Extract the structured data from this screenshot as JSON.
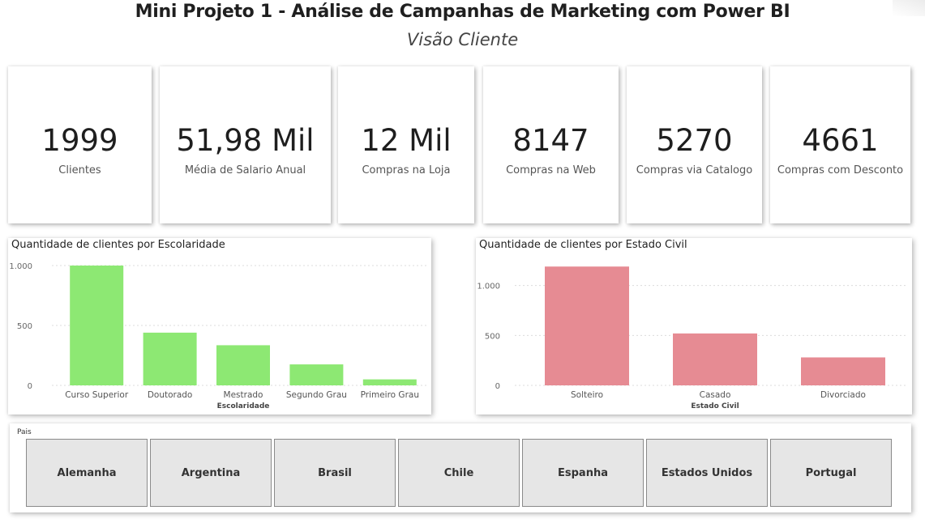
{
  "header": {
    "title": "Mini Projeto 1 - Análise de Campanhas de Marketing com Power BI",
    "subtitle": "Visão Cliente"
  },
  "kpis": [
    {
      "value": "1999",
      "label": "Clientes"
    },
    {
      "value": "51,98 Mil",
      "label": "Média de Salario Anual"
    },
    {
      "value": "12 Mil",
      "label": "Compras na Loja"
    },
    {
      "value": "8147",
      "label": "Compras na Web"
    },
    {
      "value": "5270",
      "label": "Compras via Catalogo"
    },
    {
      "value": "4661",
      "label": "Compras com Desconto"
    }
  ],
  "chart_data": [
    {
      "type": "bar",
      "title": "Quantidade de clientes por Escolaridade",
      "xlabel": "Escolaridade",
      "ylabel": "",
      "categories": [
        "Curso Superior",
        "Doutorado",
        "Mestrado",
        "Segundo Grau",
        "Primeiro Grau"
      ],
      "values": [
        1000,
        440,
        335,
        175,
        50
      ],
      "yticks": [
        "0",
        "500",
        "1.000"
      ],
      "ylim": [
        0,
        1000
      ],
      "color": "#8de873",
      "grid": true
    },
    {
      "type": "bar",
      "title": "Quantidade de clientes por Estado Civil",
      "xlabel": "Estado Civil",
      "ylabel": "",
      "categories": [
        "Solteiro",
        "Casado",
        "Divorciado"
      ],
      "values": [
        1190,
        520,
        280
      ],
      "yticks": [
        "0",
        "500",
        "1.000"
      ],
      "ylim": [
        0,
        1200
      ],
      "color": "#e68b93",
      "grid": true
    }
  ],
  "slicer": {
    "label": "Pais",
    "options": [
      "Alemanha",
      "Argentina",
      "Brasil",
      "Chile",
      "Espanha",
      "Estados Unidos",
      "Portugal"
    ]
  }
}
